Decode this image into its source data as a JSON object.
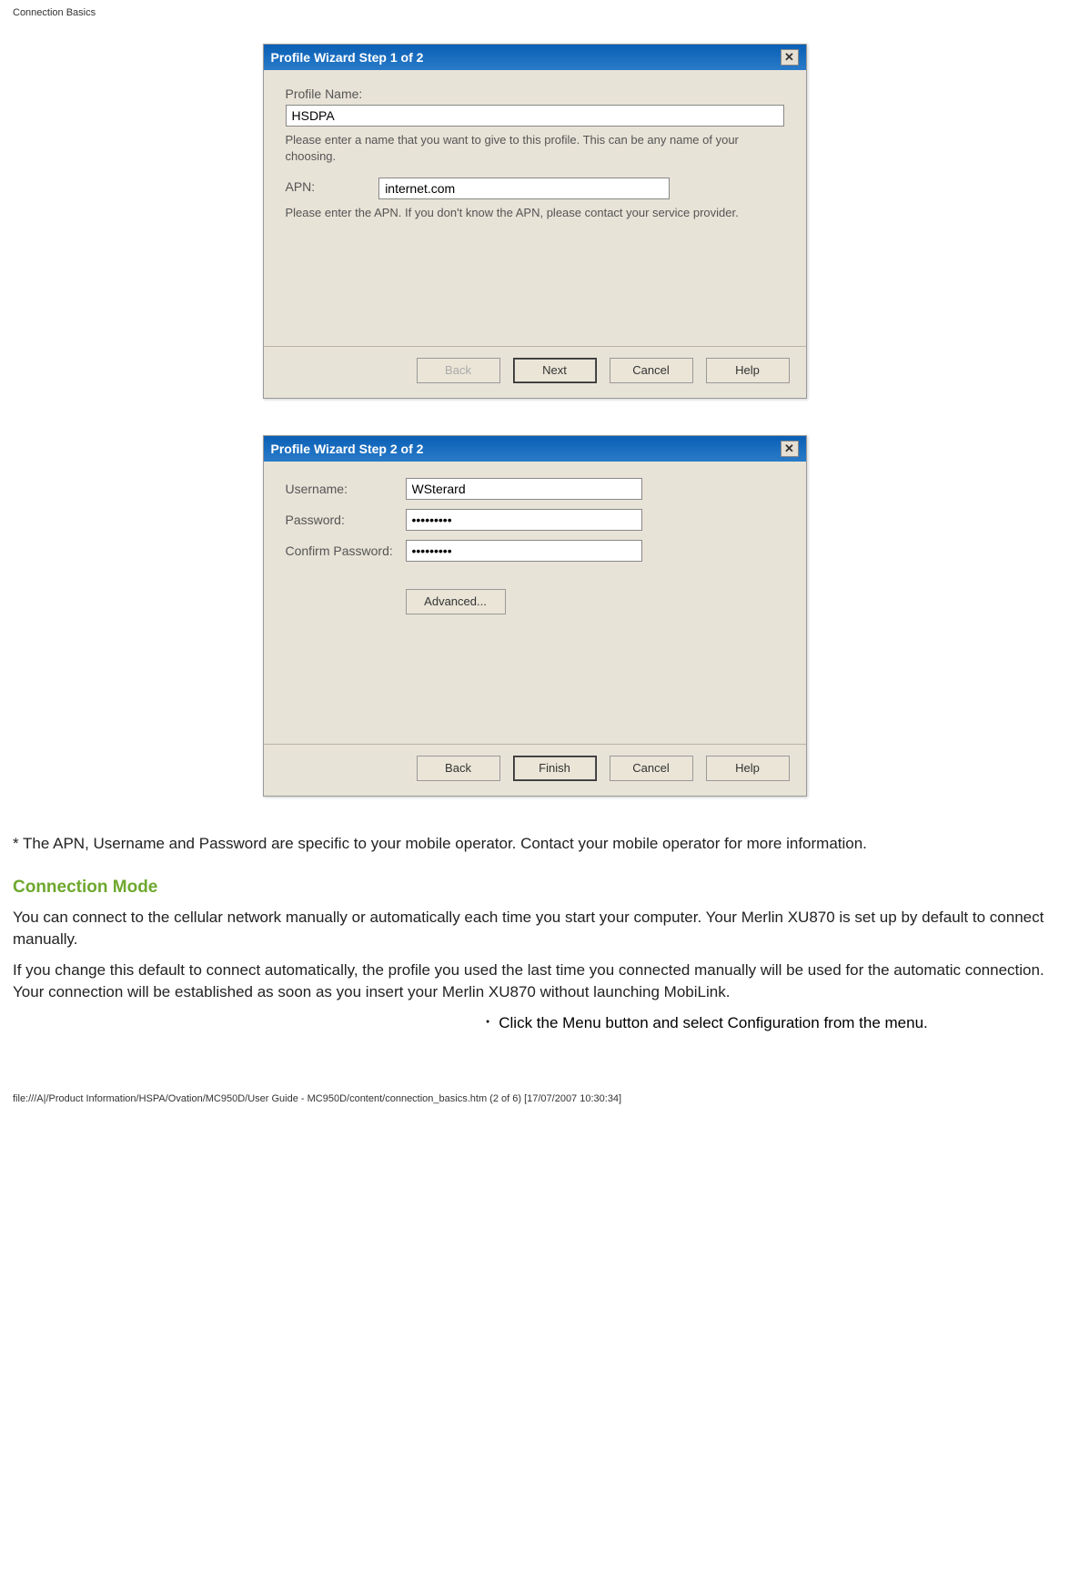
{
  "page": {
    "header": "Connection Basics",
    "footer": "file:///A|/Product Information/HSPA/Ovation/MC950D/User Guide - MC950D/content/connection_basics.htm (2 of 6) [17/07/2007 10:30:34]"
  },
  "dialog1": {
    "title": "Profile Wizard Step 1 of 2",
    "profile_name_label": "Profile Name:",
    "profile_name_value": "HSDPA",
    "profile_name_hint": "Please enter a name that you want to give to this profile. This can be any name of your choosing.",
    "apn_label": "APN:",
    "apn_value": "internet.com",
    "apn_hint": "Please enter the APN.  If you don't know the APN, please contact your service provider.",
    "buttons": {
      "back": "Back",
      "next": "Next",
      "cancel": "Cancel",
      "help": "Help"
    }
  },
  "dialog2": {
    "title": "Profile Wizard Step 2 of 2",
    "username_label": "Username:",
    "username_value": "WSterard",
    "password_label": "Password:",
    "password_value": "•••••••••",
    "confirm_label": "Confirm Password:",
    "confirm_value": "•••••••••",
    "advanced": "Advanced...",
    "buttons": {
      "back": "Back",
      "finish": "Finish",
      "cancel": "Cancel",
      "help": "Help"
    }
  },
  "text": {
    "note": "* The APN, Username and Password are specific to your mobile operator. Contact your mobile operator for more information.",
    "section_title": "Connection Mode",
    "para1": "You can connect to the cellular network manually or automatically each time you start your computer. Your Merlin XU870 is set up by default to connect manually.",
    "para2": "If you change this default to connect automatically, the profile you used the last time you connected manually will be used for the automatic connection. Your connection will be established as soon as you insert your Merlin XU870 without launching MobiLink.",
    "bullet1": "Click the Menu button and select Configuration from the menu."
  }
}
